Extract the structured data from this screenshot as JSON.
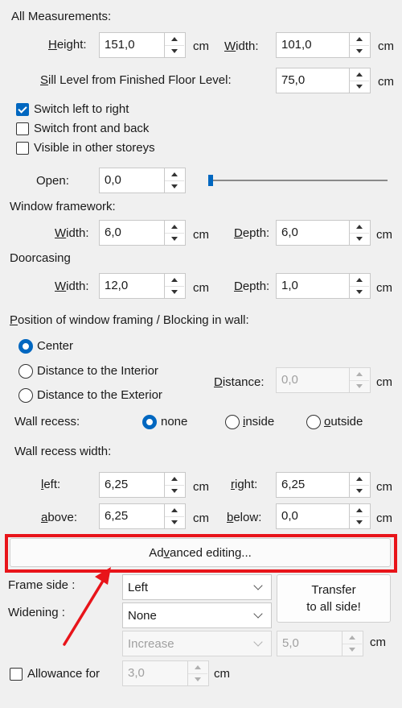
{
  "all_measurements": {
    "heading": "All Measurements:",
    "height_label_pre": "",
    "height_label_key": "H",
    "height_label_post": "eight:",
    "height_value": "151,0",
    "width_label_key": "W",
    "width_label_post": "idth:",
    "width_value": "101,0",
    "sill_label_key": "S",
    "sill_label_post": "ill Level from Finished Floor Level:",
    "sill_value": "75,0",
    "unit": "cm"
  },
  "options": {
    "switch_lr": "Switch left to right",
    "switch_fb": "Switch front and back",
    "visible_other": "Visible in other storeys",
    "switch_lr_checked": true,
    "switch_fb_checked": false,
    "visible_other_checked": false
  },
  "open": {
    "label": "Open:",
    "value": "0,0",
    "slider_position": 0
  },
  "window_framework": {
    "heading": "Window framework:",
    "width_key": "W",
    "width_post": "idth:",
    "width_value": "6,0",
    "depth_key": "D",
    "depth_post": "epth:",
    "depth_value": "6,0"
  },
  "doorcasing": {
    "heading": "Doorcasing",
    "width_key": "W",
    "width_post": "idth:",
    "width_value": "12,0",
    "depth_key": "D",
    "depth_post": "epth:",
    "depth_value": "1,0"
  },
  "position": {
    "heading_key": "P",
    "heading_post": "osition of window framing / Blocking in wall:",
    "center": "Center",
    "interior": "Distance to the Interior",
    "exterior": "Distance to the Exterior",
    "distance_key": "D",
    "distance_post": "istance:",
    "distance_value": "0,0",
    "selected": "Center"
  },
  "wall_recess": {
    "label": "Wall recess:",
    "none": "none",
    "inside_key": "i",
    "inside_post": "nside",
    "outside_key": "o",
    "outside_post": "utside",
    "selected": "none",
    "width_heading": "Wall recess width:",
    "left_key": "l",
    "left_post": "eft:",
    "left_value": "6,25",
    "right_key": "r",
    "right_post": "ight:",
    "right_value": "6,25",
    "above_key": "a",
    "above_post": "bove:",
    "above_value": "6,25",
    "below_key": "b",
    "below_post": "elow:",
    "below_value": "0,0"
  },
  "advanced": {
    "pre": "Ad",
    "key": "v",
    "post": "anced editing...",
    "highlight_color": "#e8141a"
  },
  "frame": {
    "side_label": "Frame side :",
    "side_value": "Left",
    "widening_label": "Widening :",
    "widening_value": "None",
    "increase_value": "Increase",
    "increase_amount": "5,0",
    "transfer_line1": "Transfer",
    "transfer_line2": "to all side!"
  },
  "allowance": {
    "label": "Allowance for",
    "value": "3,0",
    "checked": false
  },
  "colors": {
    "accent": "#0067c0",
    "annotation": "#e8141a"
  }
}
